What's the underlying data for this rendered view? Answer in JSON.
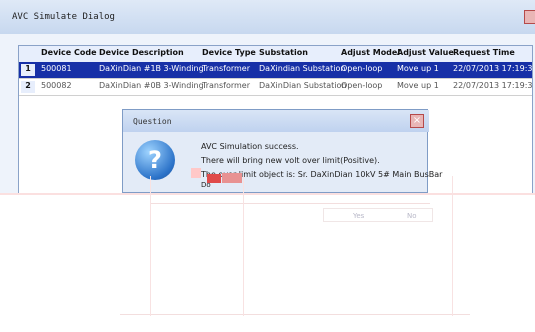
{
  "window": {
    "title": "AVC Simulate Dialog"
  },
  "table": {
    "columns": [
      "Device Code",
      "Device Description",
      "Device Type",
      "Substation",
      "Adjust Model",
      "Adjust Value",
      "Request Time"
    ],
    "rows": [
      {
        "num": "1",
        "code": "500081",
        "desc": "DaXinDian #1B 3-Winding",
        "type": "Transformer",
        "sub": "DaXindian Substation",
        "model": "Open-loop",
        "value": "Move up 1",
        "time": "22/07/2013 17:19:3"
      },
      {
        "num": "2",
        "code": "500082",
        "desc": "DaXinDian #0B 3-Winding",
        "type": "Transformer",
        "sub": "DaXinDian Substation",
        "model": "Open-loop",
        "value": "Move up 1",
        "time": "22/07/2013 17:19:3"
      }
    ]
  },
  "dialog": {
    "title": "Question",
    "icon": "question-icon",
    "lines": [
      "AVC Simulation success.",
      "There will bring new volt over limit(Positive).",
      "The over limit object is: Sr. DaXinDian 10kV 5# Main BusBar",
      "Do"
    ],
    "yes_label": "Yes",
    "no_label": "No"
  }
}
